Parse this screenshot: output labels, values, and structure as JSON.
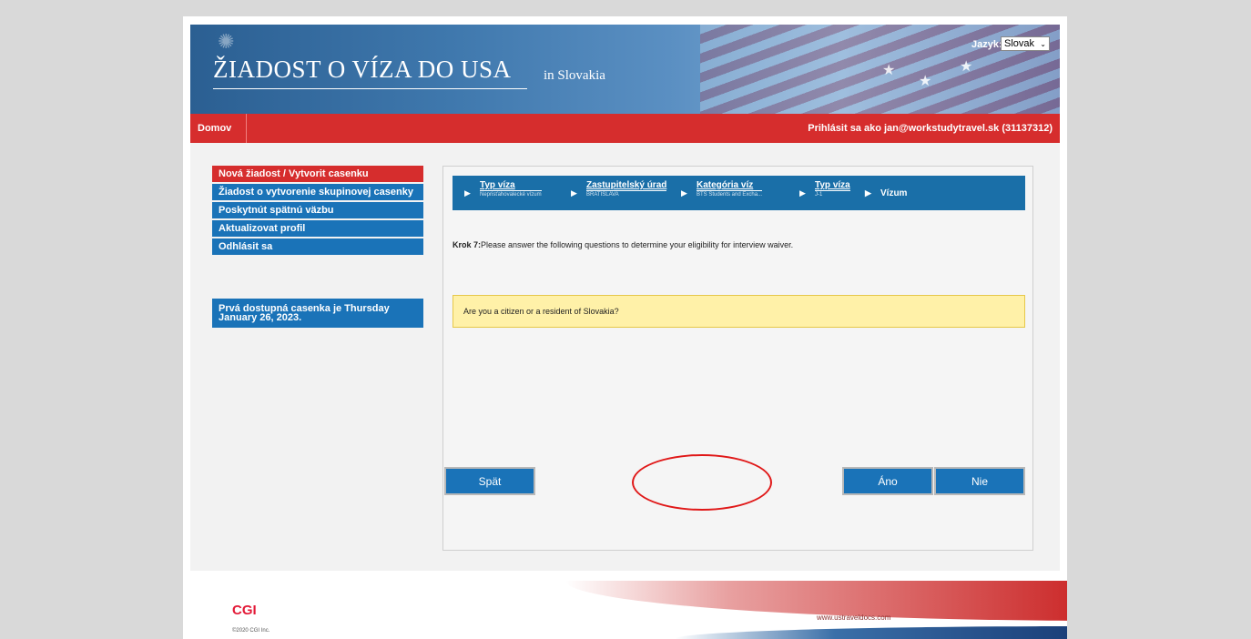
{
  "header": {
    "title": "ŽIADOST O VÍZA DO USA",
    "subtitle": "in Slovakia",
    "language_label": "Jazyk:",
    "language_value": "Slovak"
  },
  "nav": {
    "home": "Domov",
    "user": "Prihlásit sa ako  jan@workstudytravel.sk (31137312)"
  },
  "sidebar": {
    "items": [
      {
        "label": "Nová žiadost / Vytvorit casenku",
        "active": true
      },
      {
        "label": "Žiadost o vytvorenie skupinovej casenky",
        "active": false
      },
      {
        "label": "Poskytnút spätnú väzbu",
        "active": false
      },
      {
        "label": "Aktualizovat profil",
        "active": false
      },
      {
        "label": "Odhlásit sa",
        "active": false
      }
    ],
    "notice": "Prvá dostupná casenka je Thursday January 26, 2023."
  },
  "steps": [
    {
      "label": "Typ víza",
      "value": "Neprisťahovalecké vízum"
    },
    {
      "label": "Zastupitelský úrad",
      "value": "BRATISLAVA"
    },
    {
      "label": "Kategória víz",
      "value": "BTS Students and Excha..."
    },
    {
      "label": "Typ víza",
      "value": "J-1"
    },
    {
      "label": "Vízum",
      "value": ""
    }
  ],
  "instruction": {
    "step": "Krok 7:",
    "text": "Please answer the following questions to determine your eligibility for interview waiver."
  },
  "question": "Are you a citizen or a resident of Slovakia?",
  "buttons": {
    "back": "Spät",
    "yes": "Áno",
    "no": "Nie"
  },
  "footer": {
    "brand": "CGI",
    "copyright": "©2020 CGI Inc.",
    "url": "www.ustraveldocs.com"
  },
  "colors": {
    "brand_red": "#d62d2d",
    "brand_blue": "#1a73b8",
    "question_bg": "#fff1a8",
    "highlight": "#e01818"
  }
}
